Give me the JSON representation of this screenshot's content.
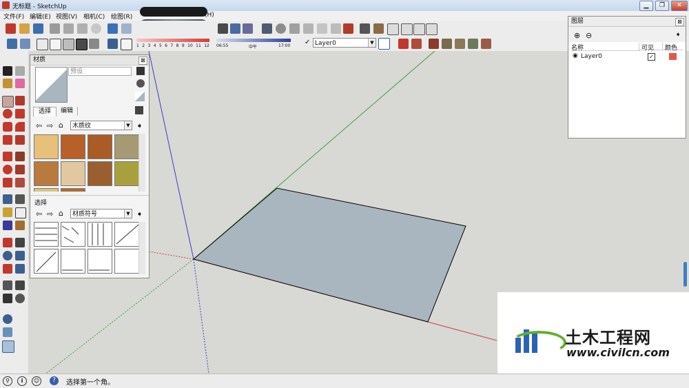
{
  "window": {
    "title": "无标题 - SketchUp",
    "minimize": "▁",
    "restore": "❐",
    "close": "✕"
  },
  "menu": [
    "文件(F)",
    "编辑(E)",
    "视图(V)",
    "相机(C)",
    "绘图(R)",
    "(H)"
  ],
  "shadow_bar": {
    "time_ticks": [
      "1",
      "2",
      "3",
      "4",
      "5",
      "6",
      "7",
      "8",
      "9",
      "10",
      "11",
      "12"
    ],
    "time_start": "06:55",
    "time_mid": "中午",
    "time_end": "17:00"
  },
  "layer_select": {
    "value": "Layer0"
  },
  "materials_panel": {
    "title": "材质",
    "preset_placeholder": "预设",
    "tabs": [
      "选择",
      "编辑"
    ],
    "library1": "木质纹",
    "section2_title": "选择",
    "library2": "材质符号",
    "swatch_colors": [
      "#e7c07a",
      "#b8602a",
      "#a95c25",
      "#a59a73",
      "#b87a3f",
      "#e2c89f",
      "#9b5f2f",
      "#a8a03e",
      "#d8c680",
      "#b06a32"
    ]
  },
  "layers_panel": {
    "title": "图层",
    "col_name": "名称",
    "col_visible": "可见",
    "col_color": "颜色",
    "row_name": "Layer0",
    "row_color": "#e05a4c"
  },
  "status": {
    "text": "选择第一个角。"
  },
  "watermark": {
    "site_name": "土木工程网",
    "url": "www.civilcn.com"
  },
  "colors": {
    "face": "#a9b5bf",
    "axis_red": "#d44040",
    "axis_green": "#3aa13a",
    "axis_blue": "#3c3cc4"
  }
}
